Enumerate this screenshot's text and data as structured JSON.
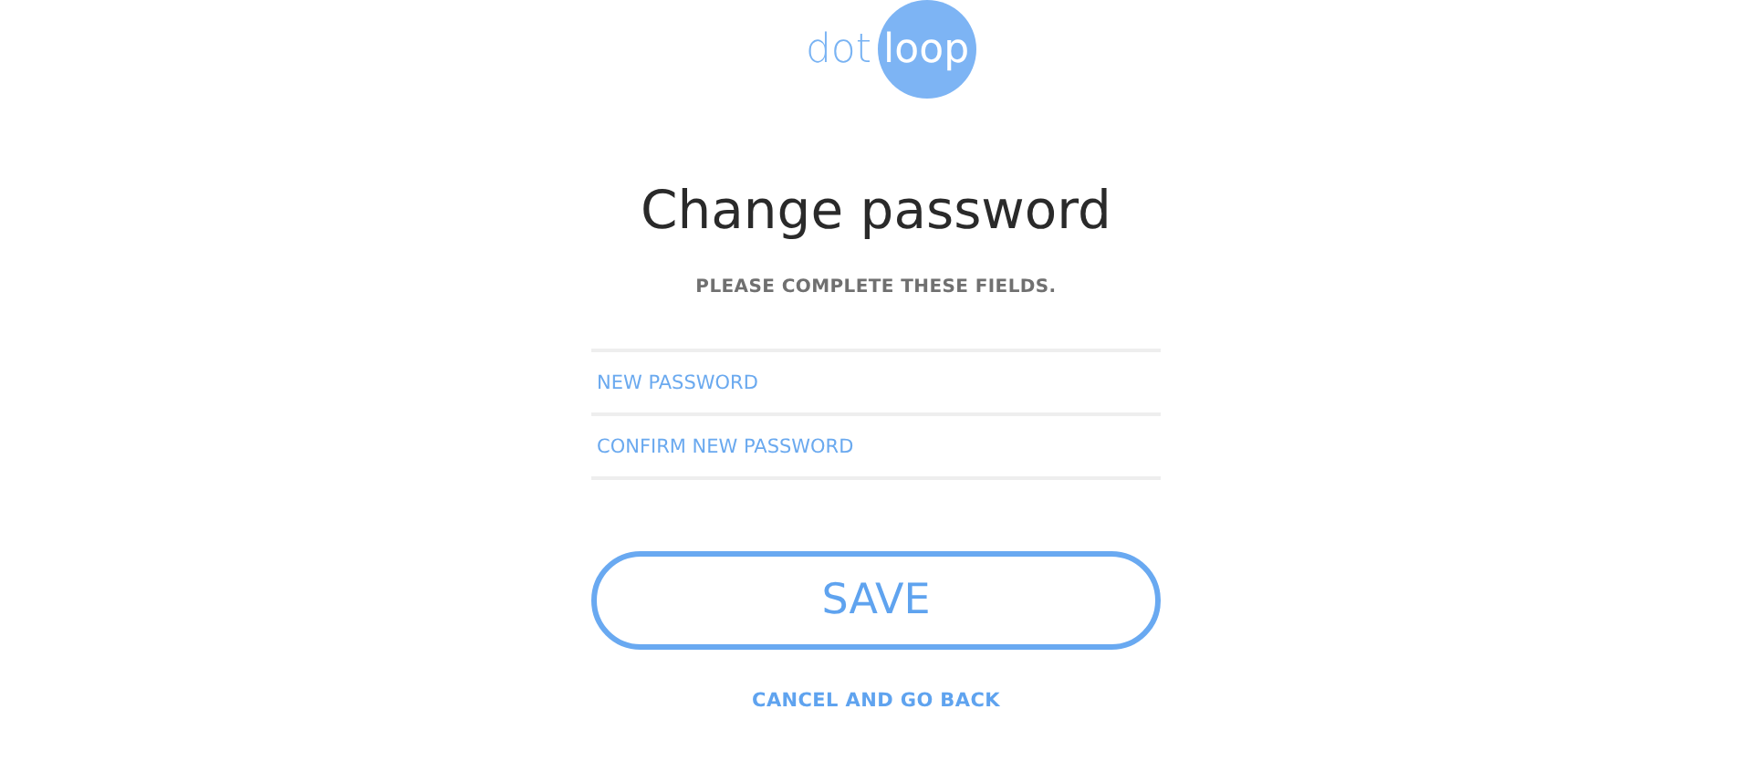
{
  "logo": {
    "word_1": "dot",
    "word_2": "loop"
  },
  "title": "Change password",
  "subtitle": "PLEASE COMPLETE THESE FIELDS.",
  "fields": [
    {
      "placeholder": "NEW PASSWORD"
    },
    {
      "placeholder": "CONFIRM NEW PASSWORD"
    }
  ],
  "save_button": "SAVE",
  "cancel_link": "CANCEL AND GO BACK"
}
